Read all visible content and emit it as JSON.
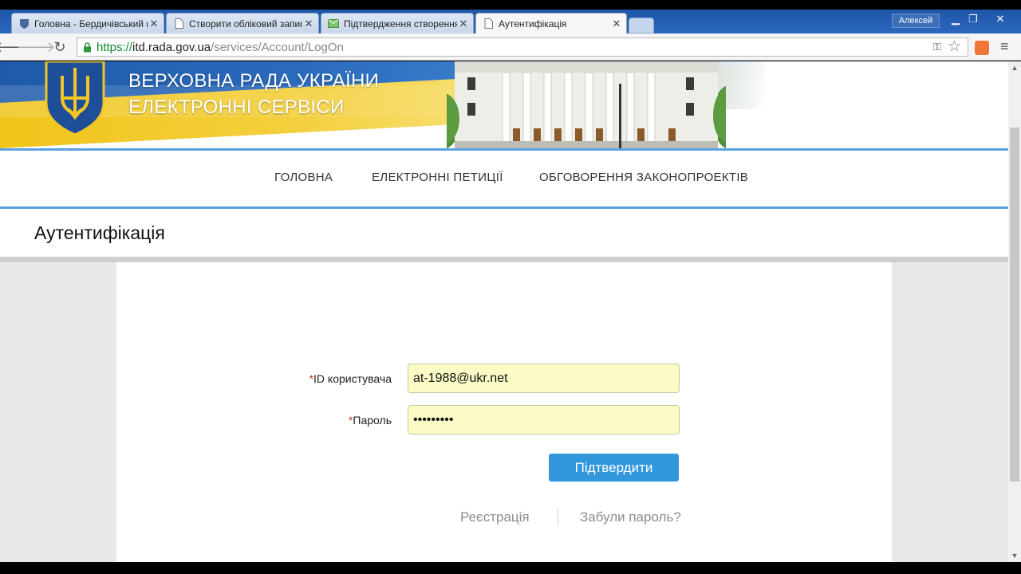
{
  "browser": {
    "tabs": [
      {
        "label": "Головна - Бердичівський к",
        "icon": "shield-favicon"
      },
      {
        "label": "Створити обліковий запис",
        "icon": "page-icon"
      },
      {
        "label": "Підтвердження створення",
        "icon": "mail-favicon"
      },
      {
        "label": "Аутентифікація",
        "icon": "page-icon",
        "active": true
      }
    ],
    "user_badge": "Алексей",
    "url": {
      "scheme": "https://",
      "host": "itd.rada.gov.ua",
      "path": "/services/Account/LogOn"
    }
  },
  "banner": {
    "line1": "ВЕРХОВНА РАДА УКРАЇНИ",
    "line2": "ЕЛЕКТРОННІ СЕРВІСИ"
  },
  "nav": {
    "items": [
      "ГОЛОВНА",
      "ЕЛЕКТРОННІ ПЕТИЦІЇ",
      "ОБГОВОРЕННЯ ЗАКОНОПРОЕКТІВ"
    ]
  },
  "page": {
    "title": "Аутентифікація"
  },
  "form": {
    "required_mark": "*",
    "user_id_label": "ID користувача",
    "user_id_value": "at-1988@ukr.net",
    "password_label": "Пароль",
    "password_value": "•••••••••",
    "submit_label": "Підтвердити",
    "register_link": "Реєстрація",
    "forgot_link": "Забули пароль?"
  },
  "colors": {
    "accent": "#3397de",
    "nav_line": "#5aa2dd",
    "input_bg": "#fbfbc5",
    "required": "#c0392b"
  }
}
